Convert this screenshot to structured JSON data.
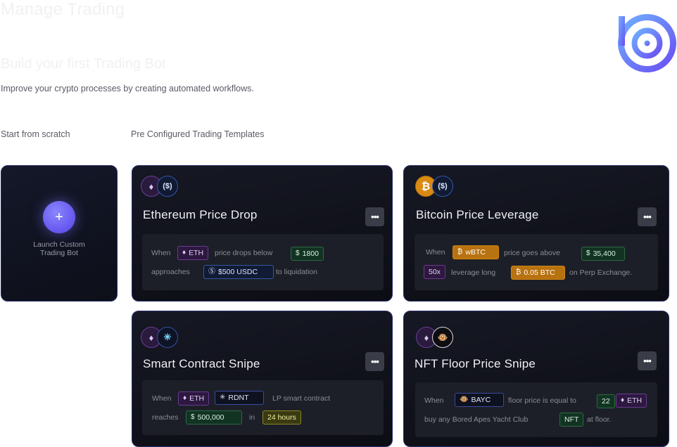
{
  "header": {
    "title": "Manage Trading",
    "section_title": "Build your first Trading Bot",
    "subtitle": "Improve your crypto processes by creating automated workflows.",
    "label_scratch": "Start from scratch",
    "label_templates": "Pre Configured Trading Templates"
  },
  "scratch": {
    "plus": "+",
    "label": "Launch Custom Trading Bot"
  },
  "cards": [
    {
      "title": "Ethereum Price Drop",
      "more": "•••",
      "when": "When",
      "chip1": "ETH",
      "text1": "price drops below",
      "chip2": "1800",
      "text2": "approaches",
      "chip3": "$500 USDC",
      "text3": "to liquidation"
    },
    {
      "title": "Bitcoin Price Leverage",
      "more": "•••",
      "when": "When",
      "chip1": "wBTC",
      "text1": "price goes above",
      "chip2": "35,400",
      "chip3": "50x",
      "text2": "leverage long",
      "chip4": "0.05 BTC",
      "text3": "on Perp Exchange."
    },
    {
      "title": "Smart Contract Snipe",
      "more": "•••",
      "when": "When",
      "chip1": "ETH",
      "chip2": "RDNT",
      "text1": "LP smart contract",
      "text2": "reaches",
      "chip3": "500,000",
      "text3": "in",
      "chip4": "24 hours"
    },
    {
      "title": "NFT Floor Price Snipe",
      "more": "•••",
      "when": "When",
      "chip1": "BAYC",
      "text1": "floor price is equal to",
      "chip2": "22",
      "chip3": "ETH",
      "text2": "buy any Bored Apes Yacht Club",
      "chip4": "NFT",
      "text3": "at floor."
    }
  ],
  "icons": {
    "eth": "ethereum-icon",
    "usdc": "usdc-icon",
    "btc": "bitcoin-icon",
    "rdnt": "radiant-icon",
    "bayc": "bayc-icon",
    "dollar": "dollar-icon"
  },
  "colors": {
    "accent": "#6a5cf0",
    "card_border": "#2b2f6b",
    "logo": "#6f63f5"
  }
}
